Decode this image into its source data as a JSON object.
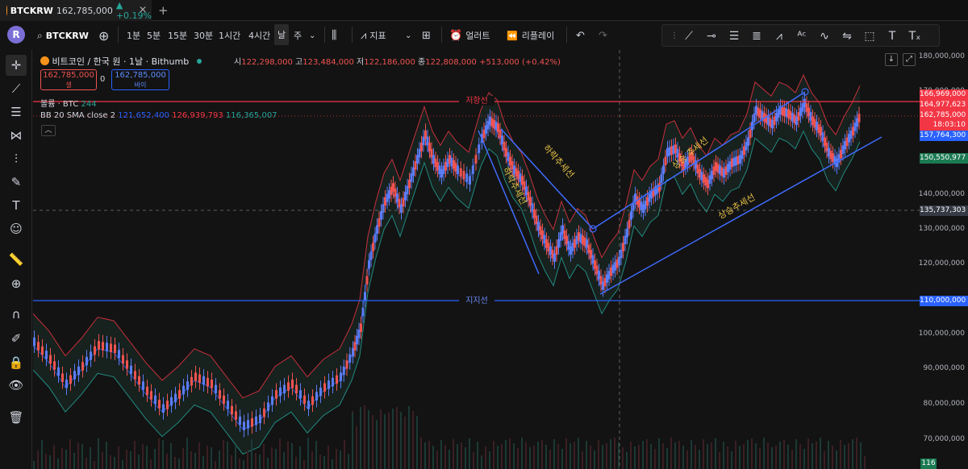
{
  "tab": {
    "symbol": "BTCKRW",
    "price": "162,785,000",
    "change": "▲ +0.19%",
    "close": "✕",
    "new_tab": "+"
  },
  "toolbar": {
    "avatar": "R",
    "symbol": "BTCKRW",
    "intervals": [
      "1분",
      "5분",
      "15분",
      "30분",
      "1시간",
      "4시간",
      "날",
      "주"
    ],
    "indicators_label": "지표",
    "alert_label": "얼러트",
    "replay_label": "리플레이"
  },
  "legend": {
    "title": "비트코인 / 한국 원 · 1날 · Bithumb",
    "open_label": "시",
    "open": "122,298,000",
    "high_label": "고",
    "high": "123,484,000",
    "low_label": "저",
    "low": "122,186,000",
    "close_label": "종",
    "close": "122,808,000",
    "change": "+513,000 (+0.42%)",
    "sell_price": "162,785,000",
    "sell_label": "셀",
    "buy_price": "162,785,000",
    "buy_label": "바이",
    "spread": "0",
    "volume_label": "볼륨 · BTC",
    "volume_value": "244",
    "bb_label": "BB 20 SMA close 2",
    "bb_basis": "121,652,400",
    "bb_upper": "126,939,793",
    "bb_lower": "116,365,007",
    "collapse": "︿"
  },
  "annotations": {
    "resistance": "저항선",
    "support": "지지선",
    "downtrend1": "하락추세선",
    "downtrend2": "하락추세선",
    "uptrend1": "상승 추세선",
    "uptrend2": "상승추세선"
  },
  "price_axis": {
    "ticks": [
      "180,000,000",
      "170,000,000",
      "140,000,000",
      "130,000,000",
      "120,000,000",
      "100,000,000",
      "90,000,000",
      "80,000,000",
      "70,000,000"
    ],
    "tags": {
      "high": "166,969,000",
      "bb_upper": "164,977,623",
      "last": "162,785,000",
      "countdown": "18:03:10",
      "bb_basis": "157,764,300",
      "bb_lower": "150,550,977",
      "crosshair": "135,737,303",
      "support": "110,000,000",
      "volume": "116"
    }
  },
  "colors": {
    "up": "#26a69a",
    "down": "#ef5350",
    "accent": "#2962ff",
    "resistance": "#f23645",
    "support": "#2962ff",
    "bb_upper": "#f23645",
    "bb_basis": "#2962ff",
    "bb_lower": "#26a69a",
    "annotation": "#e8c547"
  }
}
